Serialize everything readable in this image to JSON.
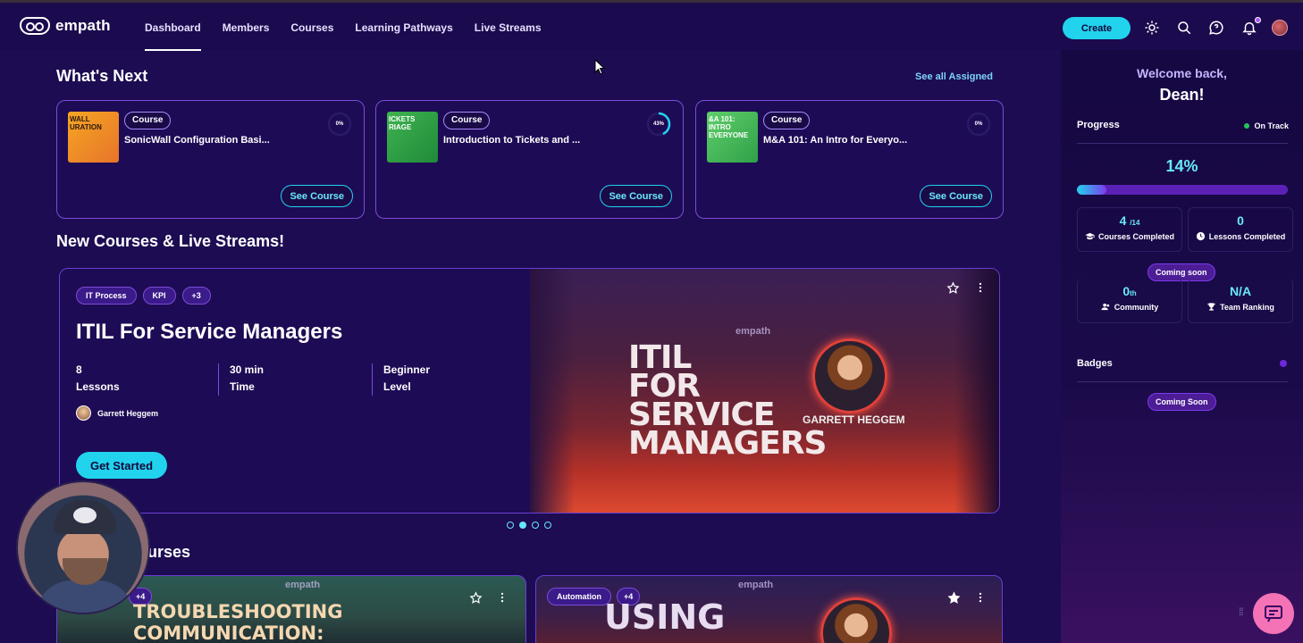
{
  "nav": {
    "brand": "empath",
    "links": [
      "Dashboard",
      "Members",
      "Courses",
      "Learning Pathways",
      "Live Streams"
    ],
    "active": "Dashboard",
    "create_label": "Create",
    "icons": [
      "sun-icon",
      "search-icon",
      "chat-icon",
      "bell-icon",
      "avatar"
    ]
  },
  "whats_next": {
    "heading": "What's Next",
    "see_all": "See all Assigned",
    "cards": [
      {
        "tag": "Course",
        "title": "SonicWall Configuration Basi...",
        "percent": "0%",
        "progress": 0,
        "button": "See Course",
        "thumb_text": "WALL\nURATION"
      },
      {
        "tag": "Course",
        "title": "Introduction to Tickets and ...",
        "percent": "43%",
        "progress": 43,
        "button": "See Course",
        "thumb_text": "ICKETS\nRIAGE"
      },
      {
        "tag": "Course",
        "title": "M&A 101: An Intro for Everyo...",
        "percent": "0%",
        "progress": 0,
        "button": "See Course",
        "thumb_text": "&A 101:\nINTRO\nEVERYONE"
      }
    ]
  },
  "new_section": {
    "heading": "New Courses & Live Streams!",
    "hero": {
      "tags": [
        "IT Process",
        "KPI",
        "+3"
      ],
      "title": "ITIL For Service Managers",
      "stats": [
        {
          "value": "8",
          "label": "Lessons"
        },
        {
          "value": "30 min",
          "label": "Time"
        },
        {
          "value": "Beginner",
          "label": "Level"
        }
      ],
      "author": "Garrett Heggem",
      "cta": "Get Started",
      "image_brand": "empath",
      "image_title": [
        "ITIL",
        "FOR",
        "SERVICE",
        "MANAGERS"
      ],
      "image_presenter": "GARRETT HEGGEM"
    },
    "carousel_active": 2,
    "carousel_count": 4
  },
  "bottom_section": {
    "heading_partial": "urses",
    "cards": [
      {
        "tags": [
          "+4"
        ],
        "brand": "empath",
        "title_lines": [
          "TROUBLESHOOTING",
          "COMMUNICATION:"
        ],
        "starred": false
      },
      {
        "tags": [
          "Automation",
          "+4"
        ],
        "brand": "empath",
        "title_lines": [
          "USING"
        ],
        "starred": true
      }
    ]
  },
  "sidebar": {
    "welcome": "Welcome back,",
    "name": "Dean!",
    "progress_label": "Progress",
    "status": "On Track",
    "percent": "14%",
    "progress": 14,
    "courses_completed": {
      "value": "4",
      "of": "/14",
      "label": "Courses Completed"
    },
    "lessons_completed": {
      "value": "0",
      "label": "Lessons Completed"
    },
    "coming_soon_1": "Coming soon",
    "community": {
      "value": "0",
      "suffix": "th",
      "label": "Community"
    },
    "team_ranking": {
      "value": "N/A",
      "label": "Team Ranking"
    },
    "badges_label": "Badges",
    "coming_soon_2": "Coming Soon"
  },
  "colors": {
    "background": "#1d0c52",
    "accent": "#22d3ee",
    "card_border": "#7c4cd6",
    "status_green": "#22c55e",
    "chat_fab": "#f472b6"
  }
}
